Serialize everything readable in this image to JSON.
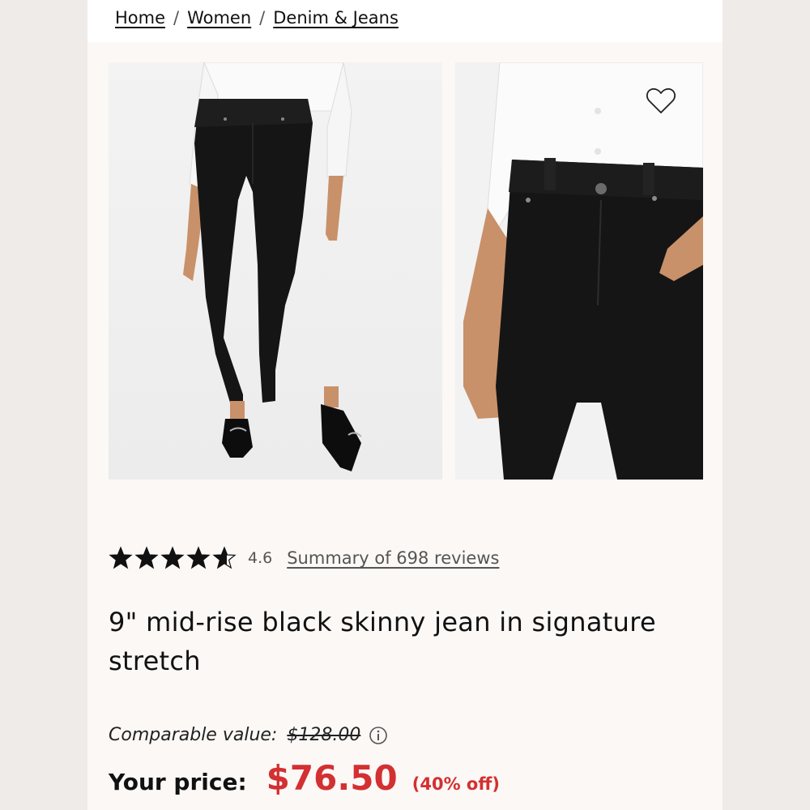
{
  "breadcrumb": {
    "items": [
      "Home",
      "Women",
      "Denim & Jeans"
    ],
    "separator": "/"
  },
  "product": {
    "rating": "4.6",
    "rating_value": 4.6,
    "rating_max": 5,
    "reviews_link": "Summary of 698 reviews",
    "title": "9\" mid-rise black skinny jean in signature stretch",
    "comparable_label": "Comparable value:",
    "comparable_price": "$128.00",
    "price_label": "Your price:",
    "price": "$76.50",
    "discount": "(40% off)"
  },
  "icons": {
    "wishlist": "heart-outline-icon",
    "info": "info-circle-icon",
    "star": "star-icon"
  },
  "colors": {
    "sale_red": "#d33032",
    "text": "#111111",
    "page_bg": "#fbf8f6",
    "jeans_black": "#151515"
  }
}
